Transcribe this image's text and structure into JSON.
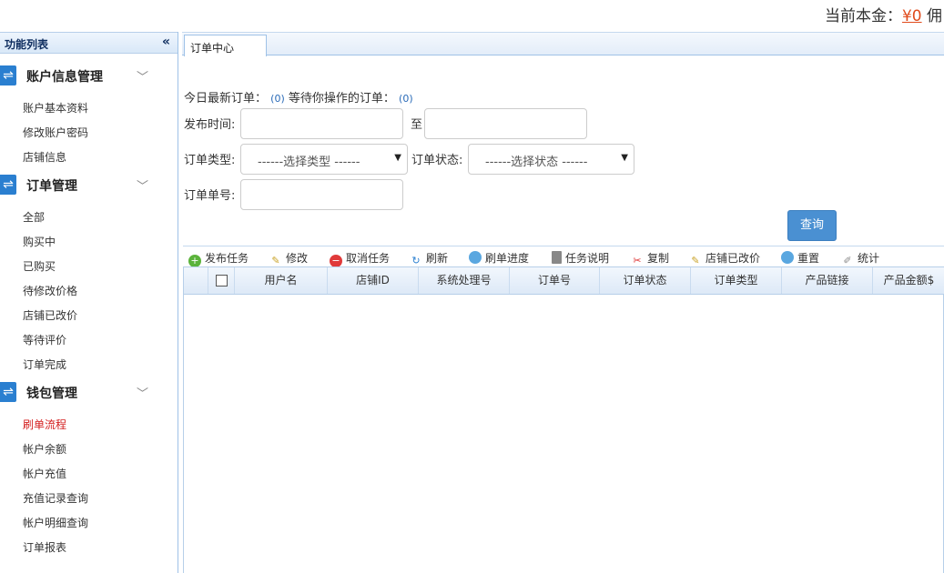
{
  "topbar": {
    "balance_label": "当前本金：",
    "balance_amount": "¥0",
    "trailing": "佣"
  },
  "sidebar": {
    "title": "功能列表",
    "collapse_glyph": "«",
    "groups": [
      {
        "label": "账户信息管理",
        "items": [
          "账户基本资料",
          "修改账户密码",
          "店铺信息"
        ]
      },
      {
        "label": "订单管理",
        "items": [
          "全部",
          "购买中",
          "已购买",
          "待修改价格",
          "店铺已改价",
          "等待评价",
          "订单完成"
        ]
      },
      {
        "label": "钱包管理",
        "items": [
          "刷单流程",
          "帐户余额",
          "帐户充值",
          "充值记录查询",
          "帐户明细查询",
          "订单报表"
        ]
      }
    ],
    "active_item": "刷单流程",
    "group_icon": "swap-arrows-icon",
    "chevron_icon": "chevron-down-icon"
  },
  "tab": {
    "label": "订单中心"
  },
  "summary": {
    "today_label": "今日最新订单：",
    "today_count": "(0)",
    "waiting_label": "等待你操作的订单：",
    "waiting_count": "(0)"
  },
  "filters": {
    "publish_time_label": "发布时间:",
    "to_label": "至",
    "order_type_label": "订单类型:",
    "order_type_value": "------选择类型 ------",
    "order_status_label": "订单状态:",
    "order_status_value": "------选择状态 ------",
    "order_no_label": "订单单号:",
    "query_button": "查询"
  },
  "toolbar": [
    {
      "label": "发布任务",
      "icon": "add-icon"
    },
    {
      "label": "修改",
      "icon": "pencil-icon"
    },
    {
      "label": "取消任务",
      "icon": "cancel-icon"
    },
    {
      "label": "刷新",
      "icon": "refresh-icon"
    },
    {
      "label": "刷单进度",
      "icon": "progress-icon"
    },
    {
      "label": "任务说明",
      "icon": "document-icon"
    },
    {
      "label": "复制",
      "icon": "scissors-icon"
    },
    {
      "label": "店铺已改价",
      "icon": "pencil-icon"
    },
    {
      "label": "重置",
      "icon": "reset-icon"
    },
    {
      "label": "统计",
      "icon": "stats-icon"
    }
  ],
  "grid": {
    "columns": [
      "用户名",
      "店铺ID",
      "系统处理号",
      "订单号",
      "订单状态",
      "订单类型",
      "产品链接",
      "产品金额$"
    ]
  },
  "colors": {
    "accent": "#4a90d2",
    "active_nav": "#d42020",
    "amount": "#e04b1c"
  }
}
